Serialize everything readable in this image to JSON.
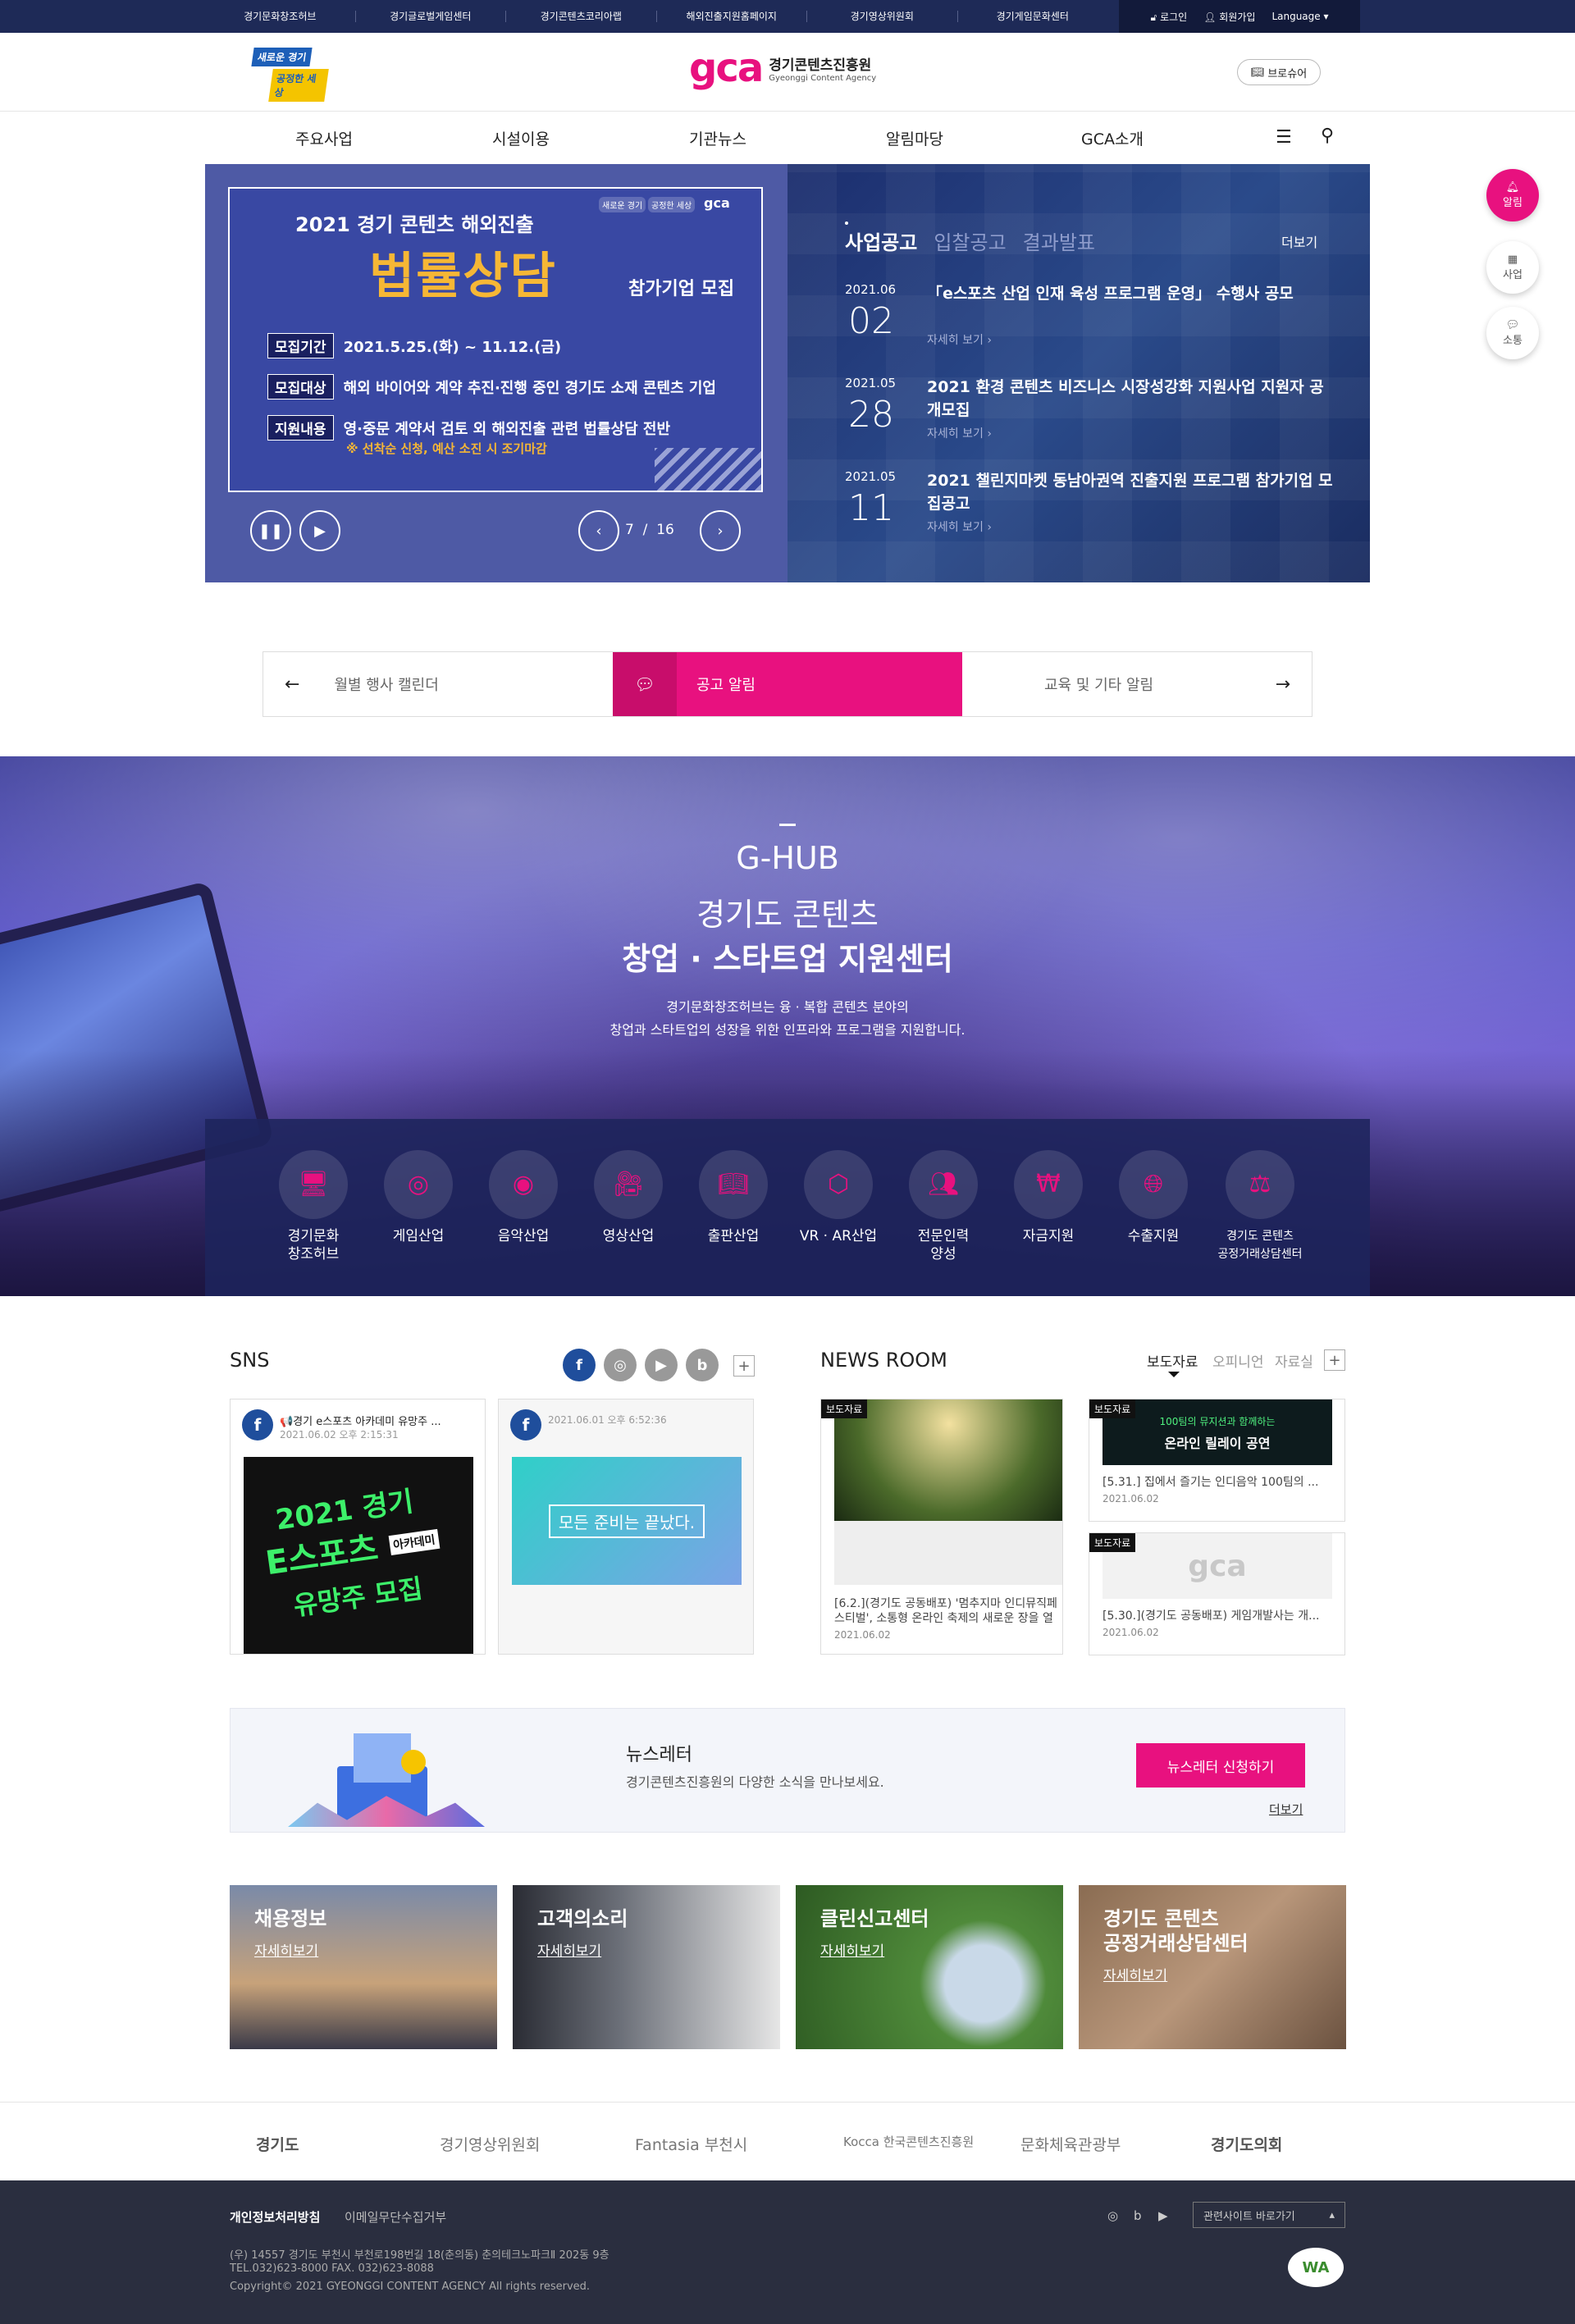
{
  "util": {
    "links": [
      "경기문화창조허브",
      "경기글로벌게임센터",
      "경기콘텐츠코리아랩",
      "해외진출지원홈페이지",
      "경기영상위원회",
      "경기게임문화센터"
    ],
    "login": "로그인",
    "join": "회원가입",
    "language": "Language"
  },
  "header": {
    "slogan_1": "새로운 경기",
    "slogan_2": "공정한 세상",
    "logo_mark": "gca",
    "logo_ko": "경기콘텐츠진흥원",
    "logo_en": "Gyeonggi Content Agency",
    "brochure": "브로슈어"
  },
  "gnb": [
    "주요사업",
    "시설이용",
    "기관뉴스",
    "알림마당",
    "GCA소개"
  ],
  "side": {
    "alarm": "알림",
    "biz": "사업",
    "comm": "소통"
  },
  "banner": {
    "title": "2021 경기 콘텐츠 해외진출",
    "big": "법률상담",
    "sub": "참가기업 모집",
    "tag1": "새로운 경기",
    "tag2": "공정한 세상",
    "rows": [
      {
        "label": "모집기간",
        "text": "2021.5.25.(화) ~ 11.12.(금)"
      },
      {
        "label": "모집대상",
        "text": "해외 바이어와 계약 추진·진행 중인 경기도 소재 콘텐츠 기업"
      },
      {
        "label": "지원내용",
        "text": "영·중문 계약서 검토 외 해외진출 관련 법률상담 전반"
      }
    ],
    "note": "※ 선착순 신청, 예산 소진 시 조기마감",
    "current": "7",
    "sep": "/",
    "total": "16"
  },
  "notices": {
    "tabs": [
      "사업공고",
      "입찰공고",
      "결과발표"
    ],
    "more": "더보기",
    "items": [
      {
        "ym": "2021.06",
        "day": "02",
        "title": "「e스포츠 산업 인재 육성 프로그램 운영」 수행사 공모",
        "more": "자세히 보기"
      },
      {
        "ym": "2021.05",
        "day": "28",
        "title": "2021 환경 콘텐츠 비즈니스 시장성강화 지원사업 지원자 공개모집",
        "more": "자세히 보기"
      },
      {
        "ym": "2021.05",
        "day": "11",
        "title": "2021 챌린지마켓 동남아권역 진출지원 프로그램 참가기업 모집공고",
        "more": "자세히 보기"
      }
    ]
  },
  "quick": {
    "left": "월별 행사 캘린더",
    "center": "공고 알림",
    "right": "교육 및 기타 알림"
  },
  "ghub": {
    "title": "G-HUB",
    "line1": "경기도 콘텐츠",
    "line2": "창업 · 스타트업 지원센터",
    "desc1": "경기문화창조허브는 융 · 복합 콘텐츠 분야의",
    "desc2": "창업과 스타트업의 성장을 위한 인프라와 프로그램을 지원합니다.",
    "fields": [
      {
        "l1": "경기문화",
        "l2": "창조허브",
        "icon": "monitor-icon"
      },
      {
        "l1": "게임산업",
        "l2": "",
        "icon": "vr-icon"
      },
      {
        "l1": "음악산업",
        "l2": "",
        "icon": "disc-icon"
      },
      {
        "l1": "영상산업",
        "l2": "",
        "icon": "camera-icon"
      },
      {
        "l1": "출판산업",
        "l2": "",
        "icon": "book-icon"
      },
      {
        "l1": "VR · AR산업",
        "l2": "",
        "icon": "cube-icon"
      },
      {
        "l1": "전문인력",
        "l2": "양성",
        "icon": "people-icon"
      },
      {
        "l1": "자금지원",
        "l2": "",
        "icon": "won-icon"
      },
      {
        "l1": "수출지원",
        "l2": "",
        "icon": "globe-icon"
      },
      {
        "l1": "경기도 콘텐츠",
        "l2": "공정거래상담센터",
        "icon": "scale-icon"
      }
    ]
  },
  "sns": {
    "title": "SNS",
    "posts": [
      {
        "title": "📢경기 e스포츠 아카데미 유망주 ...",
        "date": "2021.06.02 오후 2:15:31",
        "img_l1": "2021 경기",
        "img_l2": "E스포츠",
        "img_l3": "유망주 모집",
        "img_tag": "아카데미"
      },
      {
        "title": "",
        "date": "2021.06.01 오후 6:52:36",
        "img_text": "모든 준비는 끝났다."
      }
    ]
  },
  "news": {
    "title": "NEWS ROOM",
    "tabs": [
      "보도자료",
      "오피니언",
      "자료실"
    ],
    "items": [
      {
        "badge": "보도자료",
        "title": "[6.2.](경기도 공동배포) '멈추지마 인디뮤직페스티벌', 소통형 온라인 축제의 새로운 장을 열",
        "date": "2021.06.02"
      },
      {
        "badge": "보도자료",
        "title": "[5.31.] 집에서 즐기는 인디음악 100팀의 ...",
        "date": "2021.06.02",
        "img_l1": "100팀의 뮤지션과 함께하는",
        "img_l2": "온라인 릴레이 공연"
      },
      {
        "badge": "보도자료",
        "title": "[5.30.](경기도 공동배포) 게임개발사는 개...",
        "date": "2021.06.02",
        "img_logo": "gca"
      }
    ]
  },
  "newsletter": {
    "title": "뉴스레터",
    "desc": "경기콘텐츠진흥원의 다양한 소식을 만나보세요.",
    "button": "뉴스레터 신청하기",
    "more": "더보기"
  },
  "promos": [
    {
      "title": "채용정보",
      "title2": "",
      "link": "자세히보기"
    },
    {
      "title": "고객의소리",
      "title2": "",
      "link": "자세히보기"
    },
    {
      "title": "클린신고센터",
      "title2": "",
      "link": "자세히보기"
    },
    {
      "title": "경기도 콘텐츠",
      "title2": "공정거래상담센터",
      "link": "자세히보기"
    }
  ],
  "partners": [
    "경기도",
    "경기영상위원회",
    "Fantasia 부천시",
    "Kocca 한국콘텐츠진흥원",
    "문화체육관광부",
    "경기도의회"
  ],
  "footer": {
    "privacy": "개인정보처리방침",
    "email": "이메일무단수집거부",
    "address": "(우) 14557 경기도 부천시 부천로198번길 18(춘의동) 춘의테크노파크Ⅱ 202동 9층",
    "tel": "TEL.032)623-8000 FAX. 032)623-8088",
    "copyright": "Copyright© 2021 GYEONGGI CONTENT AGENCY All rights reserved.",
    "related": "관련사이트 바로가기",
    "mark": "WA"
  },
  "colors": {
    "navy": "#1e2a57",
    "pink": "#e8117f",
    "purple": "#5d57c9",
    "footer": "#2a2e3f"
  }
}
